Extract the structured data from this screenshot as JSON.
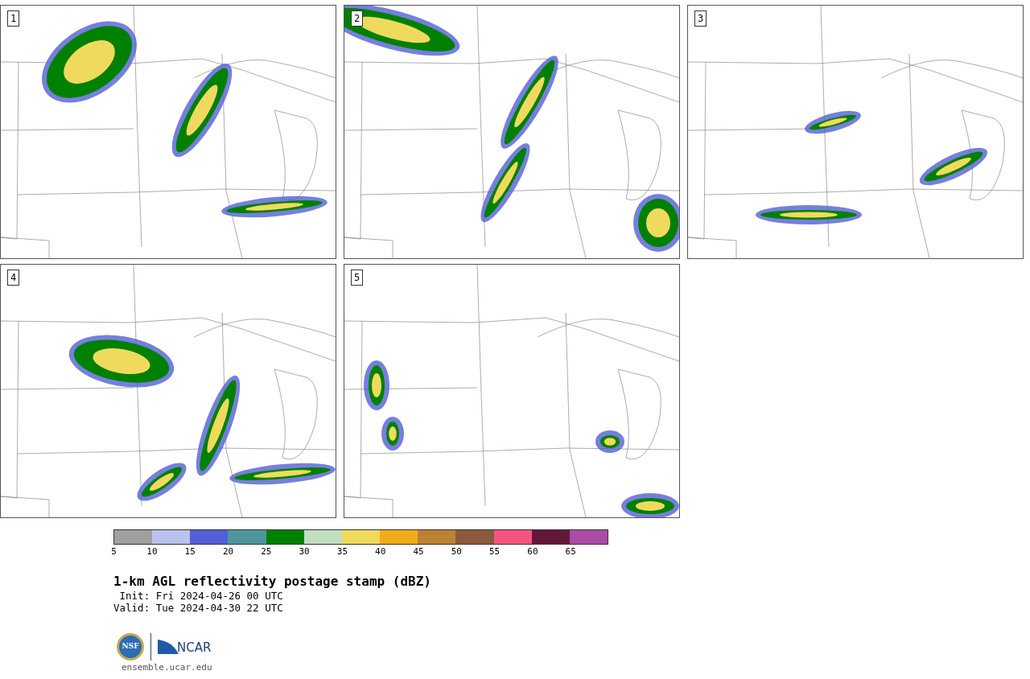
{
  "panels": [
    {
      "label": "1"
    },
    {
      "label": "2"
    },
    {
      "label": "3"
    },
    {
      "label": "4"
    },
    {
      "label": "5"
    }
  ],
  "colorbar": {
    "bins": [
      {
        "label": "5",
        "color": "#a0a0a0"
      },
      {
        "label": "10",
        "color": "#b8c2ed"
      },
      {
        "label": "15",
        "color": "#525fd6"
      },
      {
        "label": "20",
        "color": "#4f969c"
      },
      {
        "label": "25",
        "color": "#008000"
      },
      {
        "label": "30",
        "color": "#bfdfbf"
      },
      {
        "label": "35",
        "color": "#f0da5e"
      },
      {
        "label": "40",
        "color": "#f0ad19"
      },
      {
        "label": "45",
        "color": "#bc8232"
      },
      {
        "label": "50",
        "color": "#8b5a3c"
      },
      {
        "label": "55",
        "color": "#f55480"
      },
      {
        "label": "60",
        "color": "#63183a"
      },
      {
        "label": "65",
        "color": "#aa4ca6"
      }
    ]
  },
  "title": "1-km AGL reflectivity postage stamp (dBZ)",
  "init": " Init: Fri 2024-04-26 00 UTC",
  "valid": "Valid: Tue 2024-04-30 22 UTC",
  "logos": {
    "nsf": "NSF",
    "ncar": "NCAR"
  },
  "footer": "ensemble.ucar.edu"
}
